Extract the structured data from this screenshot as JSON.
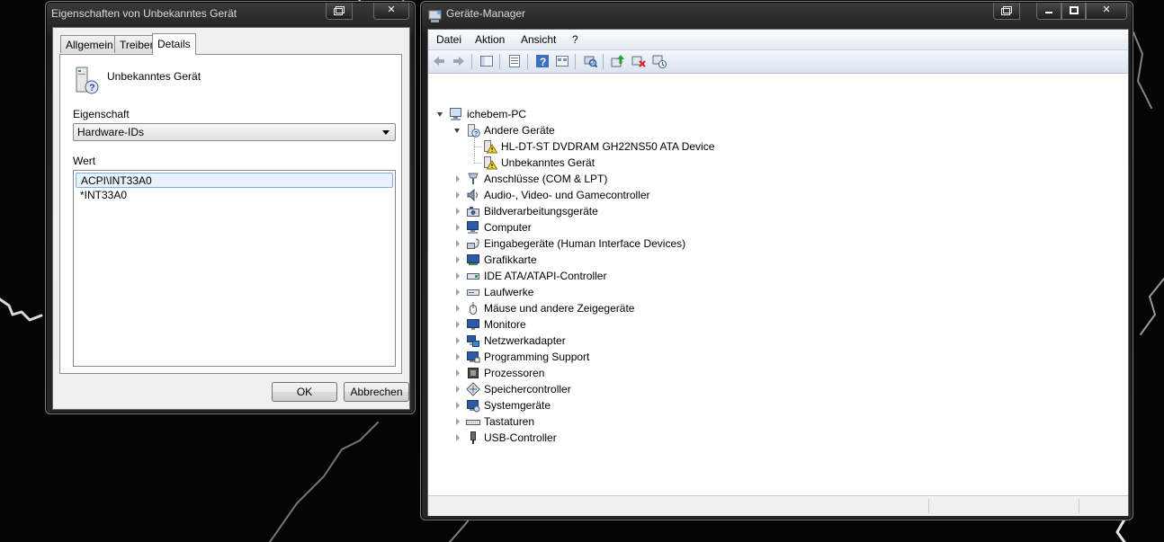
{
  "properties_dialog": {
    "title": "Eigenschaften von Unbekanntes Gerät",
    "close_glyph": "✕",
    "tabs": [
      "Allgemein",
      "Treiber",
      "Details"
    ],
    "active_tab": "Details",
    "device_name": "Unbekanntes Gerät",
    "property_label": "Eigenschaft",
    "property_value": "Hardware-IDs",
    "value_label": "Wert",
    "values": [
      "ACPI\\INT33A0",
      "*INT33A0"
    ],
    "ok_label": "OK",
    "cancel_label": "Abbrechen"
  },
  "device_manager": {
    "title": "Geräte-Manager",
    "menu": [
      "Datei",
      "Aktion",
      "Ansicht",
      "?"
    ],
    "toolbar_icons": [
      "back-icon",
      "forward-icon",
      "console-tree-icon",
      "properties-icon",
      "help-icon",
      "view-icon",
      "scan-hardware-icon",
      "update-driver-icon",
      "uninstall-icon",
      "disable-icon"
    ],
    "tree": {
      "root": "ichebem-PC",
      "other_devices": {
        "label": "Andere Geräte",
        "children": [
          "HL-DT-ST DVDRAM GH22NS50 ATA Device",
          "Unbekanntes Gerät"
        ]
      },
      "categories": [
        {
          "label": "Anschlüsse (COM & LPT)",
          "icon": "port-icon"
        },
        {
          "label": "Audio-, Video- und Gamecontroller",
          "icon": "speaker-icon"
        },
        {
          "label": "Bildverarbeitungsgeräte",
          "icon": "camera-icon"
        },
        {
          "label": "Computer",
          "icon": "computer-icon"
        },
        {
          "label": "Eingabegeräte (Human Interface Devices)",
          "icon": "hid-icon"
        },
        {
          "label": "Grafikkarte",
          "icon": "display-adapter-icon"
        },
        {
          "label": "IDE ATA/ATAPI-Controller",
          "icon": "ide-controller-icon"
        },
        {
          "label": "Laufwerke",
          "icon": "disk-drive-icon"
        },
        {
          "label": "Mäuse und andere Zeigegeräte",
          "icon": "mouse-icon"
        },
        {
          "label": "Monitore",
          "icon": "monitor-icon"
        },
        {
          "label": "Netzwerkadapter",
          "icon": "network-adapter-icon"
        },
        {
          "label": "Programming Support",
          "icon": "programming-support-icon"
        },
        {
          "label": "Prozessoren",
          "icon": "processor-icon"
        },
        {
          "label": "Speichercontroller",
          "icon": "storage-controller-icon"
        },
        {
          "label": "Systemgeräte",
          "icon": "system-devices-icon"
        },
        {
          "label": "Tastaturen",
          "icon": "keyboard-icon"
        },
        {
          "label": "USB-Controller",
          "icon": "usb-icon"
        }
      ]
    }
  }
}
